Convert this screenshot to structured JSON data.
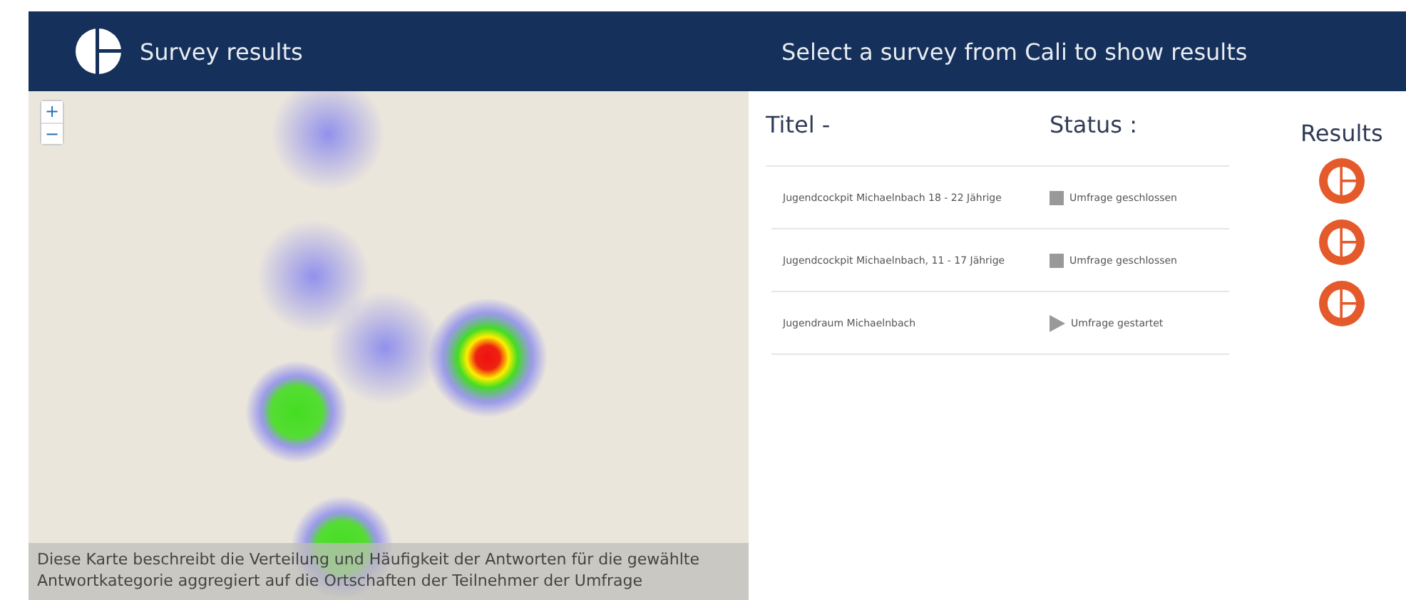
{
  "header": {
    "title": "Survey results",
    "prompt": "Select a survey from Cali to show results"
  },
  "map": {
    "zoom_in": "+",
    "zoom_out": "−",
    "caption": "Diese Karte beschreibt die Verteilung und Häufigkeit der Antworten für die gewählte Antwortkategorie aggregiert auf die Ortschaften der Teilnehmer der Umfrage"
  },
  "table": {
    "columns": [
      "Titel -",
      "Status :",
      "Results"
    ],
    "rows": [
      {
        "title": "Jugendcockpit Michaelnbach 18 - 22 Jährige",
        "status": "Umfrage geschlossen",
        "kind": "closed"
      },
      {
        "title": "Jugendcockpit Michaelnbach, 11 - 17 Jährige",
        "status": "Umfrage geschlossen",
        "kind": "closed"
      },
      {
        "title": "Jugendraum Michaelnbach",
        "status": "Umfrage gestartet",
        "kind": "started"
      }
    ]
  }
}
